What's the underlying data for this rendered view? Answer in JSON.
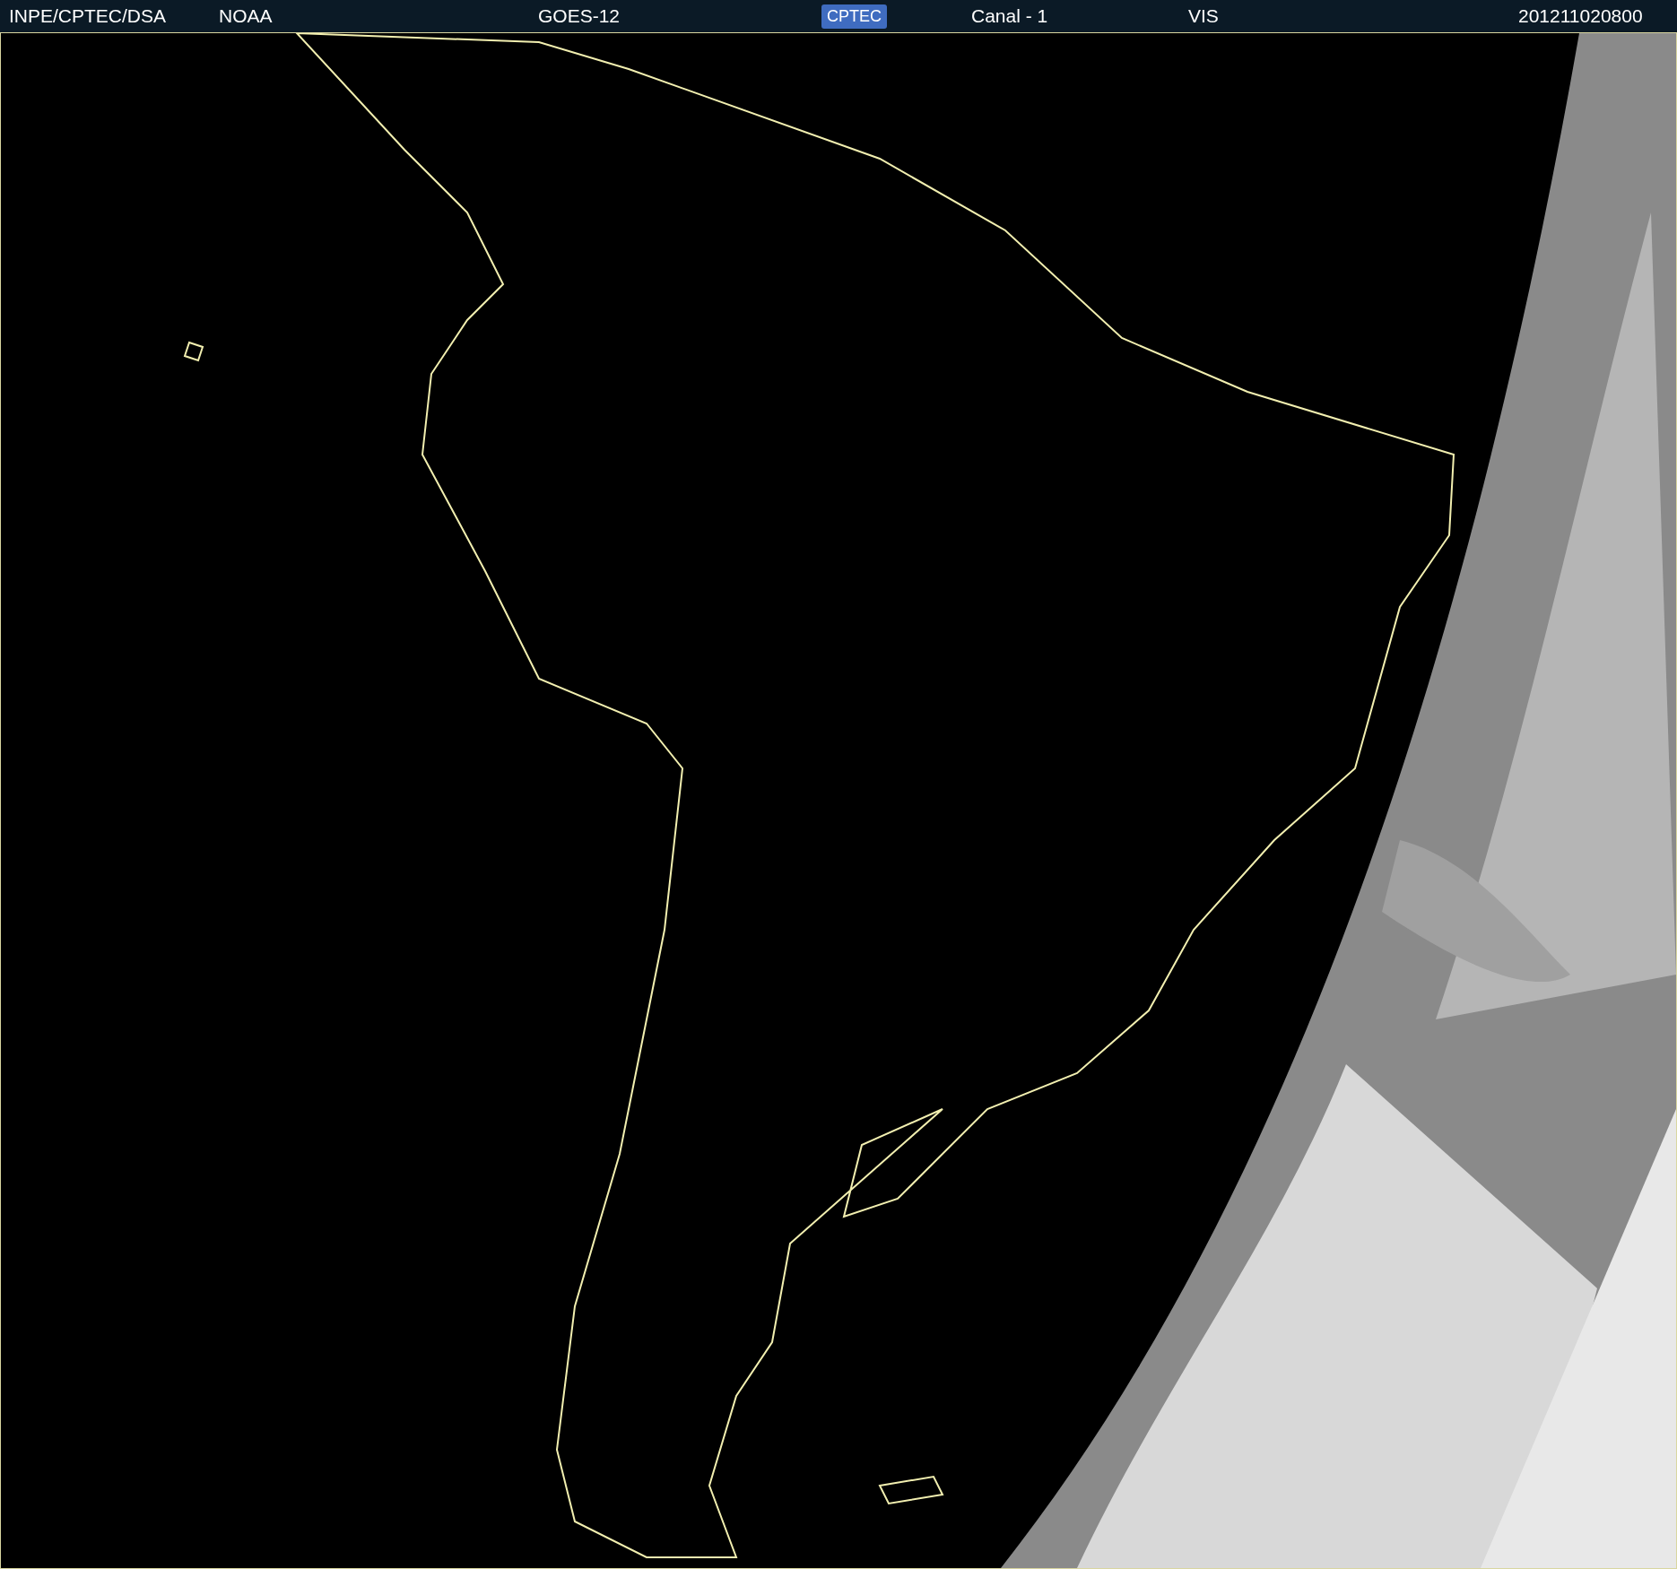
{
  "header": {
    "source": "INPE/CPTEC/DSA",
    "agency": "NOAA",
    "satellite": "GOES-12",
    "logo": "CPTEC",
    "channel": "Canal - 1",
    "band": "VIS",
    "timestamp": "201211020800"
  }
}
